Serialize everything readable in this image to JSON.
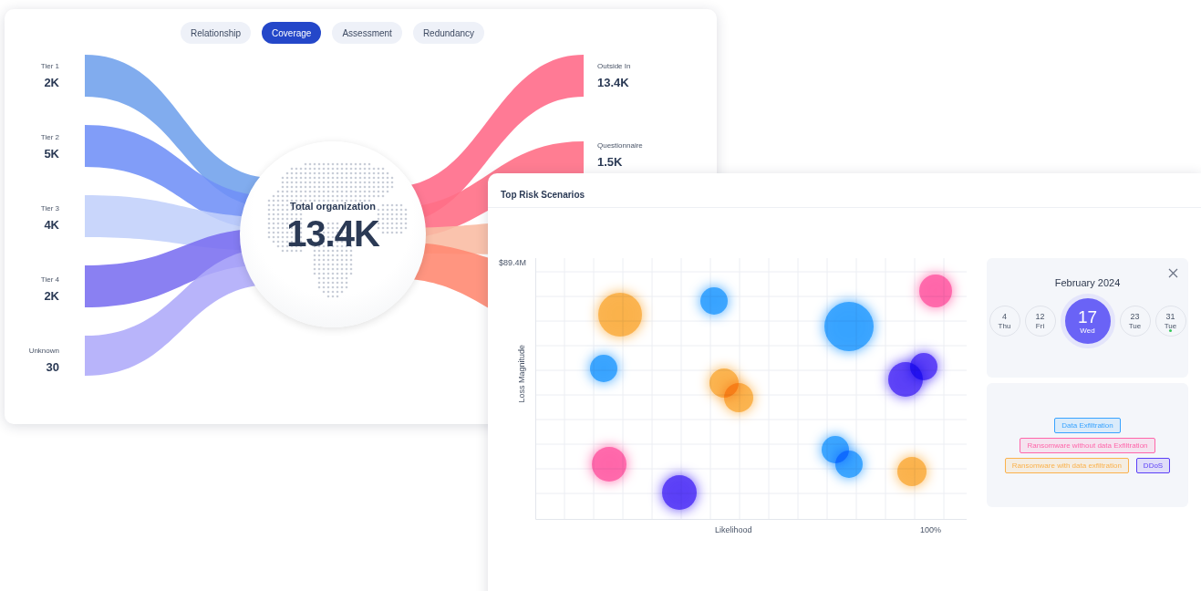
{
  "tabs": [
    {
      "label": "Relationship",
      "selected": false
    },
    {
      "label": "Coverage",
      "selected": true
    },
    {
      "label": "Assessment",
      "selected": false
    },
    {
      "label": "Redundancy",
      "selected": false
    }
  ],
  "sources": [
    {
      "label": "Tier 1",
      "value": "2K"
    },
    {
      "label": "Tier 2",
      "value": "5K"
    },
    {
      "label": "Tier 3",
      "value": "4K"
    },
    {
      "label": "Tier 4",
      "value": "2K"
    },
    {
      "label": "Unknown",
      "value": "30"
    }
  ],
  "center": {
    "label": "Total organization",
    "value": "13.4K"
  },
  "targets": [
    {
      "label": "Outside In",
      "value": "13.4K"
    },
    {
      "label": "Questionnaire",
      "value": "1.5K"
    }
  ],
  "risk_panel": {
    "title": "Top Risk Scenarios",
    "y_tick": "$89.4M",
    "y_label": "Loss Magnitude",
    "x_label": "Likelihood",
    "x_tick": "100%"
  },
  "calendar": {
    "month": "February 2024",
    "days": [
      {
        "day": "4",
        "weekday": "Thu",
        "selected": false,
        "has_event": false
      },
      {
        "day": "12",
        "weekday": "Fri",
        "selected": false,
        "has_event": false
      },
      {
        "day": "17",
        "weekday": "Wed",
        "selected": true,
        "has_event": false
      },
      {
        "day": "23",
        "weekday": "Tue",
        "selected": false,
        "has_event": false
      },
      {
        "day": "31",
        "weekday": "Tue",
        "selected": false,
        "has_event": true
      }
    ]
  },
  "legend": [
    {
      "label": "Data Exfiltration",
      "color": "#38a3ff"
    },
    {
      "label": "Ransomware without data Exfiltration",
      "color": "#ff66aa"
    },
    {
      "label": "Ransomware with data exfiltration",
      "color": "#fbb24c"
    },
    {
      "label": "DDoS",
      "color": "#5b3ff7"
    }
  ]
}
